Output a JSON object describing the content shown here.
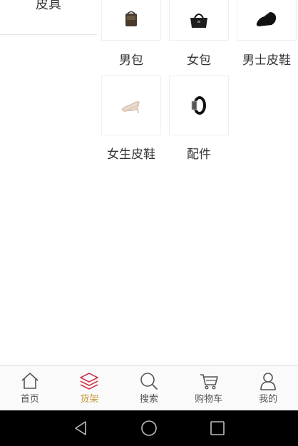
{
  "categories": {
    "active": "皮具"
  },
  "products": [
    {
      "label": "男包",
      "icon": "mens-bag-icon"
    },
    {
      "label": "女包",
      "icon": "womens-bag-icon"
    },
    {
      "label": "男士皮鞋",
      "icon": "mens-shoe-icon"
    },
    {
      "label": "女生皮鞋",
      "icon": "womens-shoe-icon"
    },
    {
      "label": "配件",
      "icon": "belt-icon"
    }
  ],
  "tabbar": {
    "items": [
      {
        "label": "首页",
        "icon": "home-icon"
      },
      {
        "label": "货架",
        "icon": "layers-icon",
        "active": true
      },
      {
        "label": "搜索",
        "icon": "search-icon"
      },
      {
        "label": "购物车",
        "icon": "cart-icon"
      },
      {
        "label": "我的",
        "icon": "user-icon"
      }
    ],
    "active_color": "#c89a3e",
    "active_icon_color": "#d0344a"
  }
}
